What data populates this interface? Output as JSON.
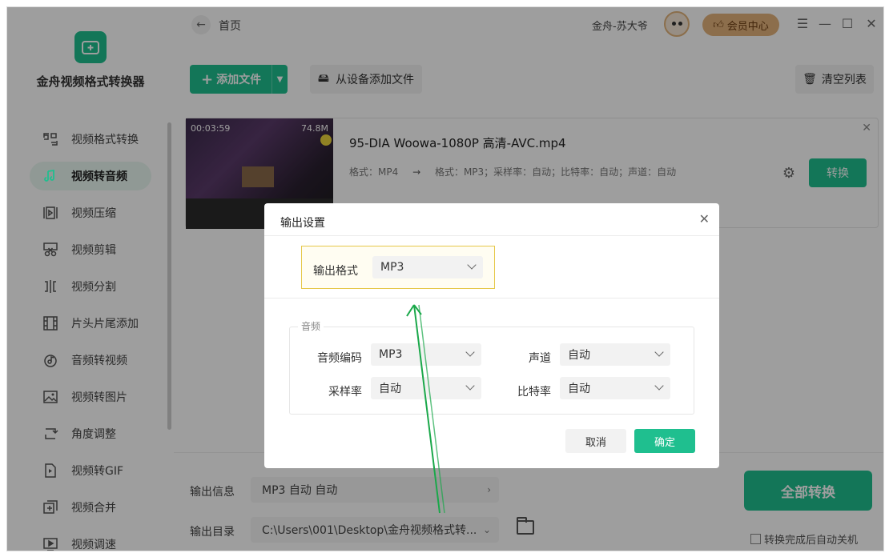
{
  "app": {
    "name": "金舟视频格式转换器",
    "accent_color": "#1fbf8f"
  },
  "header": {
    "back_icon": "arrow-left-icon",
    "breadcrumb": "首页",
    "user_name": "金舟-苏大爷",
    "vip_label": "会员中心"
  },
  "sidebar": {
    "items": [
      {
        "label": "视频格式转换",
        "icon": "format-convert-icon"
      },
      {
        "label": "视频转音频",
        "icon": "audio-icon"
      },
      {
        "label": "视频压缩",
        "icon": "compress-icon"
      },
      {
        "label": "视频剪辑",
        "icon": "scissors-icon"
      },
      {
        "label": "视频分割",
        "icon": "split-icon"
      },
      {
        "label": "片头片尾添加",
        "icon": "film-icon"
      },
      {
        "label": "音频转视频",
        "icon": "music-disc-icon"
      },
      {
        "label": "视频转图片",
        "icon": "image-icon"
      },
      {
        "label": "角度调整",
        "icon": "rotate-icon"
      },
      {
        "label": "视频转GIF",
        "icon": "gif-icon"
      },
      {
        "label": "视频合并",
        "icon": "merge-icon"
      },
      {
        "label": "视频调速",
        "icon": "speed-icon"
      }
    ],
    "active_index": 1
  },
  "toolbar": {
    "add_file": "添加文件",
    "add_from_device": "从设备添加文件",
    "clear_list": "清空列表"
  },
  "file": {
    "duration": "00:03:59",
    "size": "74.8M",
    "name": "95-DIA Woowa-1080P 高清-AVC.mp4",
    "src_format": "格式：MP4",
    "arrow": "→",
    "dst_format": "格式：MP3；采样率：自动；比特率：自动；声道：自动",
    "convert": "转换"
  },
  "bottom": {
    "output_info_label": "输出信息",
    "output_info_value": "MP3  自动  自动",
    "output_dir_label": "输出目录",
    "output_dir_value": "C:\\Users\\001\\Desktop\\金舟视频格式转...",
    "convert_all": "全部转换",
    "auto_shutdown": "转换完成后自动关机"
  },
  "dialog": {
    "title": "输出设置",
    "output_format_label": "输出格式",
    "output_format_value": "MP3",
    "group_label": "音频",
    "codec_label": "音频编码",
    "codec_value": "MP3",
    "channel_label": "声道",
    "channel_value": "自动",
    "samplerate_label": "采样率",
    "samplerate_value": "自动",
    "bitrate_label": "比特率",
    "bitrate_value": "自动",
    "cancel": "取消",
    "ok": "确定"
  }
}
